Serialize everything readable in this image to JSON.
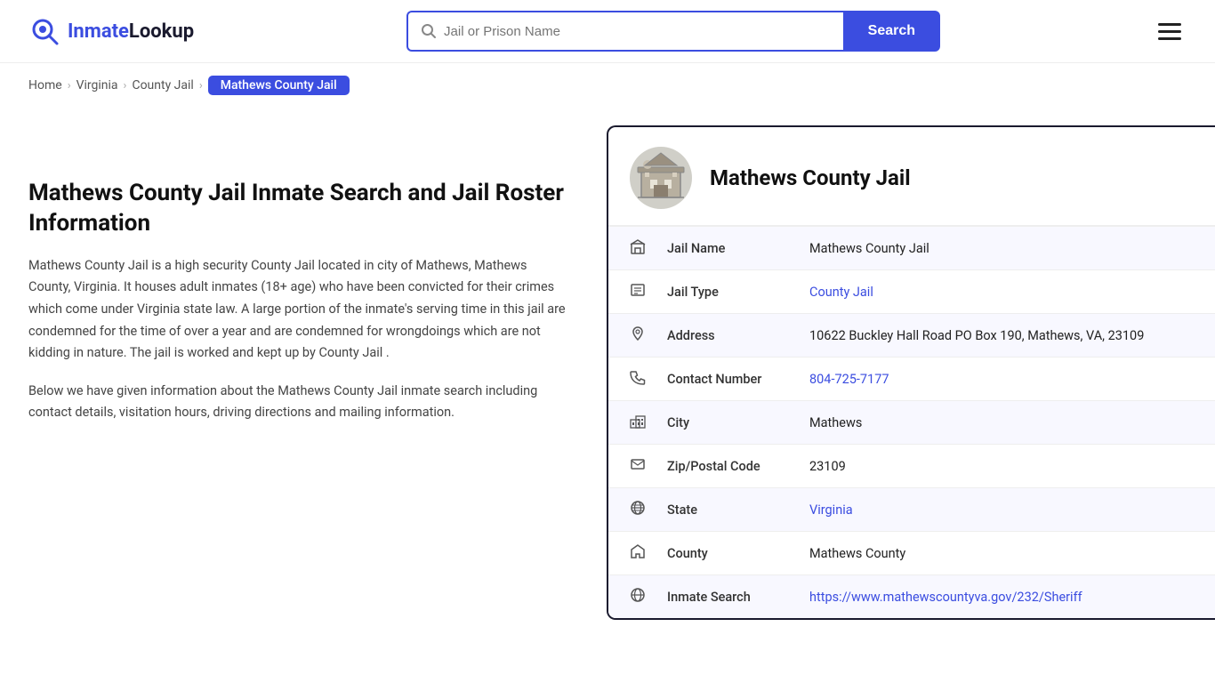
{
  "header": {
    "logo_text_part1": "Inmate",
    "logo_text_part2": "Lookup",
    "search_placeholder": "Jail or Prison Name",
    "search_button_label": "Search"
  },
  "breadcrumb": {
    "home": "Home",
    "state": "Virginia",
    "type": "County Jail",
    "active": "Mathews County Jail"
  },
  "left": {
    "title": "Mathews County Jail Inmate Search and Jail Roster Information",
    "desc1": "Mathews County Jail is a high security County Jail located in city of Mathews, Mathews County, Virginia. It houses adult inmates (18+ age) who have been convicted for their crimes which come under Virginia state law. A large portion of the inmate's serving time in this jail are condemned for the time of over a year and are condemned for wrongdoings which are not kidding in nature. The jail is worked and kept up by County Jail .",
    "desc2": "Below we have given information about the Mathews County Jail inmate search including contact details, visitation hours, driving directions and mailing information."
  },
  "card": {
    "jail_name_header": "Mathews County Jail",
    "rows": [
      {
        "label": "Jail Name",
        "value": "Mathews County Jail",
        "link": null,
        "icon": "building"
      },
      {
        "label": "Jail Type",
        "value": "County Jail",
        "link": "#",
        "icon": "list"
      },
      {
        "label": "Address",
        "value": "10622 Buckley Hall Road PO Box 190, Mathews, VA, 23109",
        "link": null,
        "icon": "pin"
      },
      {
        "label": "Contact Number",
        "value": "804-725-7177",
        "link": "tel:804-725-7177",
        "icon": "phone"
      },
      {
        "label": "City",
        "value": "Mathews",
        "link": null,
        "icon": "city"
      },
      {
        "label": "Zip/Postal Code",
        "value": "23109",
        "link": null,
        "icon": "mail"
      },
      {
        "label": "State",
        "value": "Virginia",
        "link": "#",
        "icon": "globe"
      },
      {
        "label": "County",
        "value": "Mathews County",
        "link": null,
        "icon": "county"
      },
      {
        "label": "Inmate Search",
        "value": "https://www.mathewscountyva.gov/232/Sheriff",
        "link": "https://www.mathewscountyva.gov/232/Sheriff",
        "icon": "globe2"
      }
    ]
  }
}
